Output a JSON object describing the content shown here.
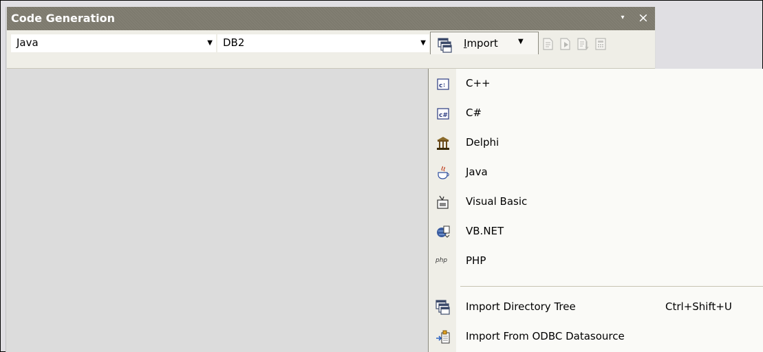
{
  "panel": {
    "title": "Code Generation",
    "pin_symbol": "▾",
    "close_symbol": "×"
  },
  "toolbar": {
    "language_combo": {
      "value": "Java",
      "arrow": "▼"
    },
    "database_combo": {
      "value": "DB2",
      "arrow": "▼"
    },
    "import_button": {
      "label_first": "I",
      "label_rest": "mport",
      "arrow": "▼",
      "icon": "import-tree-icon"
    },
    "icons": [
      "generate-code-icon",
      "generate-all-icon",
      "synchronize-icon",
      "settings-icon"
    ]
  },
  "import_menu": {
    "languages": [
      {
        "label": "C++",
        "icon": "cpp-icon"
      },
      {
        "label": "C#",
        "icon": "csharp-icon"
      },
      {
        "label": "Delphi",
        "icon": "delphi-icon"
      },
      {
        "label": "Java",
        "icon": "java-icon"
      },
      {
        "label": "Visual Basic",
        "icon": "visual-basic-icon"
      },
      {
        "label": "VB.NET",
        "icon": "vbnet-icon"
      },
      {
        "label": "PHP",
        "icon": "php-icon",
        "glyph": "php"
      }
    ],
    "directory_tree": {
      "label": "Import Directory Tree",
      "shortcut": "Ctrl+Shift+U",
      "icon": "import-tree-icon"
    },
    "odbc": {
      "label": "Import From ODBC Datasource",
      "icon": "odbc-datasource-icon"
    }
  },
  "colors": {
    "title_bar": "#7d7a6e",
    "toolbar_bg": "#efeee7",
    "menu_bg": "#fafaf7",
    "panel_bg": "#dcdcdc"
  }
}
